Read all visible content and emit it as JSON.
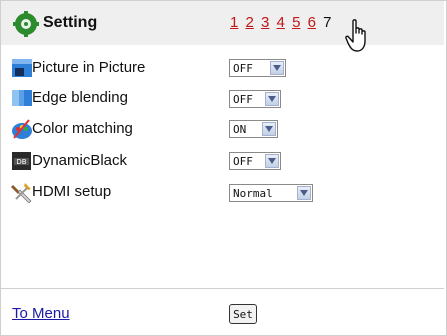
{
  "header": {
    "title": "Setting",
    "pages": [
      {
        "label": "1",
        "current": false
      },
      {
        "label": "2",
        "current": false
      },
      {
        "label": "3",
        "current": false
      },
      {
        "label": "4",
        "current": false
      },
      {
        "label": "5",
        "current": false
      },
      {
        "label": "6",
        "current": false
      },
      {
        "label": "7",
        "current": true
      }
    ]
  },
  "settings": [
    {
      "label": "Picture in Picture",
      "value": "OFF",
      "icon": "picture-in-picture-icon"
    },
    {
      "label": "Edge blending",
      "value": "OFF",
      "icon": "edge-blending-icon"
    },
    {
      "label": "Color matching",
      "value": "ON",
      "icon": "color-matching-icon"
    },
    {
      "label": "DynamicBlack",
      "value": "OFF",
      "icon": "dynamic-black-icon"
    },
    {
      "label": "HDMI setup",
      "value": "Normal",
      "icon": "hdmi-setup-icon"
    }
  ],
  "footer": {
    "menu_link": "To Menu",
    "set_label": "Set"
  },
  "colors": {
    "link_red": "#c01818",
    "link_blue": "#1a1aa6",
    "header_bg": "#efefef"
  }
}
